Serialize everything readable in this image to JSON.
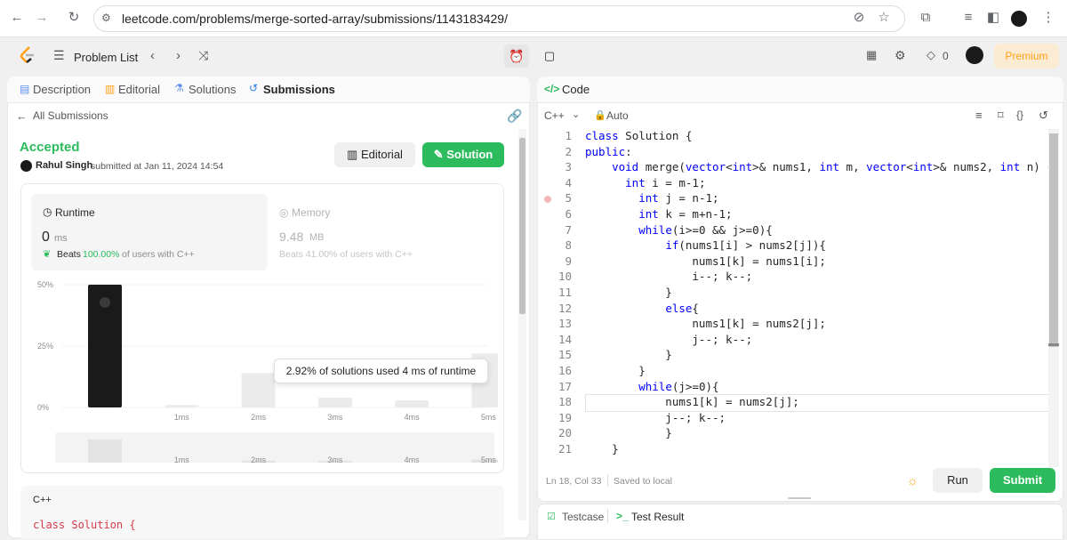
{
  "browser": {
    "url": "leetcode.com/problems/merge-sorted-array/submissions/1143183429/",
    "back_icon": "back-arrow-icon",
    "forward_icon": "forward-arrow-icon",
    "reload_icon": "reload-icon"
  },
  "nav": {
    "problem_list": "Problem List",
    "coins": "0",
    "premium": "Premium"
  },
  "tabs": {
    "description": "Description",
    "editorial": "Editorial",
    "solutions": "Solutions",
    "submissions": "Submissions"
  },
  "submission": {
    "back_link": "All Submissions",
    "status": "Accepted",
    "user": "Rahul Singh",
    "submitted_text": "submitted at Jan 11, 2024 14:54",
    "editorial_btn": "Editorial",
    "solution_btn": "Solution",
    "runtime_label": "Runtime",
    "runtime_value": "0",
    "runtime_unit": "ms",
    "beats_label": "Beats",
    "beats_value": "100.00%",
    "beats_suffix": "of users with C++",
    "memory_label": "Memory",
    "memory_value": "9.48",
    "memory_unit": "MB",
    "memory_beats": "Beats 41.00% of users with C++",
    "tooltip": "2.92% of solutions used 4 ms of runtime",
    "code_lang": "C++",
    "code_preview": "class Solution {"
  },
  "chart_data": {
    "type": "bar",
    "categories": [
      "",
      "1ms",
      "2ms",
      "3ms",
      "4ms",
      "5ms"
    ],
    "values": [
      50,
      1,
      14,
      4,
      2.92,
      22
    ],
    "yticks": [
      "50%",
      "25%",
      "0%"
    ],
    "ylim": [
      0,
      50
    ],
    "nav_ticks": [
      "1ms",
      "2ms",
      "3ms",
      "4ms",
      "5ms"
    ]
  },
  "editor": {
    "title": "Code",
    "lang": "C++",
    "mode": "Auto",
    "status_pos": "Ln 18, Col 33",
    "status_saved": "Saved to local",
    "run": "Run",
    "submit": "Submit",
    "testcase": "Testcase",
    "test_result": "Test Result",
    "lines": [
      "class Solution {",
      "public:",
      "    void merge(vector<int>& nums1, int m, vector<int>& nums2, int n) {",
      "      int i = m-1;",
      "        int j = n-1;",
      "        int k = m+n-1;",
      "        while(i>=0 && j>=0){",
      "            if(nums1[i] > nums2[j]){",
      "                nums1[k] = nums1[i];",
      "                i--; k--;",
      "            }",
      "            else{",
      "                nums1[k] = nums2[j];",
      "                j--; k--;",
      "            }",
      "        }",
      "        while(j>=0){",
      "            nums1[k] = nums2[j];",
      "            j--; k--;",
      "            }",
      "    }"
    ]
  }
}
